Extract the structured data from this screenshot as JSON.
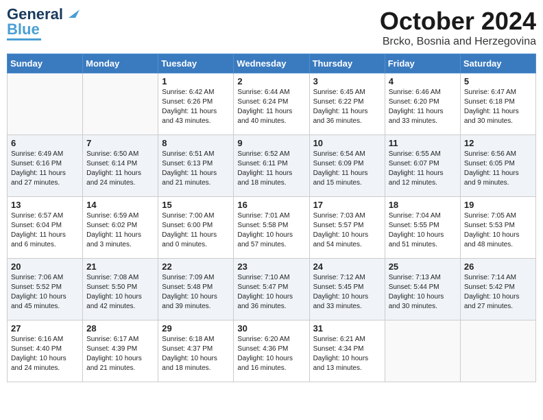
{
  "logo": {
    "line1": "General",
    "line2": "Blue"
  },
  "title": "October 2024",
  "location": "Brcko, Bosnia and Herzegovina",
  "days_of_week": [
    "Sunday",
    "Monday",
    "Tuesday",
    "Wednesday",
    "Thursday",
    "Friday",
    "Saturday"
  ],
  "weeks": [
    [
      {
        "day": "",
        "info": ""
      },
      {
        "day": "",
        "info": ""
      },
      {
        "day": "1",
        "info": "Sunrise: 6:42 AM\nSunset: 6:26 PM\nDaylight: 11 hours and 43 minutes."
      },
      {
        "day": "2",
        "info": "Sunrise: 6:44 AM\nSunset: 6:24 PM\nDaylight: 11 hours and 40 minutes."
      },
      {
        "day": "3",
        "info": "Sunrise: 6:45 AM\nSunset: 6:22 PM\nDaylight: 11 hours and 36 minutes."
      },
      {
        "day": "4",
        "info": "Sunrise: 6:46 AM\nSunset: 6:20 PM\nDaylight: 11 hours and 33 minutes."
      },
      {
        "day": "5",
        "info": "Sunrise: 6:47 AM\nSunset: 6:18 PM\nDaylight: 11 hours and 30 minutes."
      }
    ],
    [
      {
        "day": "6",
        "info": "Sunrise: 6:49 AM\nSunset: 6:16 PM\nDaylight: 11 hours and 27 minutes."
      },
      {
        "day": "7",
        "info": "Sunrise: 6:50 AM\nSunset: 6:14 PM\nDaylight: 11 hours and 24 minutes."
      },
      {
        "day": "8",
        "info": "Sunrise: 6:51 AM\nSunset: 6:13 PM\nDaylight: 11 hours and 21 minutes."
      },
      {
        "day": "9",
        "info": "Sunrise: 6:52 AM\nSunset: 6:11 PM\nDaylight: 11 hours and 18 minutes."
      },
      {
        "day": "10",
        "info": "Sunrise: 6:54 AM\nSunset: 6:09 PM\nDaylight: 11 hours and 15 minutes."
      },
      {
        "day": "11",
        "info": "Sunrise: 6:55 AM\nSunset: 6:07 PM\nDaylight: 11 hours and 12 minutes."
      },
      {
        "day": "12",
        "info": "Sunrise: 6:56 AM\nSunset: 6:05 PM\nDaylight: 11 hours and 9 minutes."
      }
    ],
    [
      {
        "day": "13",
        "info": "Sunrise: 6:57 AM\nSunset: 6:04 PM\nDaylight: 11 hours and 6 minutes."
      },
      {
        "day": "14",
        "info": "Sunrise: 6:59 AM\nSunset: 6:02 PM\nDaylight: 11 hours and 3 minutes."
      },
      {
        "day": "15",
        "info": "Sunrise: 7:00 AM\nSunset: 6:00 PM\nDaylight: 11 hours and 0 minutes."
      },
      {
        "day": "16",
        "info": "Sunrise: 7:01 AM\nSunset: 5:58 PM\nDaylight: 10 hours and 57 minutes."
      },
      {
        "day": "17",
        "info": "Sunrise: 7:03 AM\nSunset: 5:57 PM\nDaylight: 10 hours and 54 minutes."
      },
      {
        "day": "18",
        "info": "Sunrise: 7:04 AM\nSunset: 5:55 PM\nDaylight: 10 hours and 51 minutes."
      },
      {
        "day": "19",
        "info": "Sunrise: 7:05 AM\nSunset: 5:53 PM\nDaylight: 10 hours and 48 minutes."
      }
    ],
    [
      {
        "day": "20",
        "info": "Sunrise: 7:06 AM\nSunset: 5:52 PM\nDaylight: 10 hours and 45 minutes."
      },
      {
        "day": "21",
        "info": "Sunrise: 7:08 AM\nSunset: 5:50 PM\nDaylight: 10 hours and 42 minutes."
      },
      {
        "day": "22",
        "info": "Sunrise: 7:09 AM\nSunset: 5:48 PM\nDaylight: 10 hours and 39 minutes."
      },
      {
        "day": "23",
        "info": "Sunrise: 7:10 AM\nSunset: 5:47 PM\nDaylight: 10 hours and 36 minutes."
      },
      {
        "day": "24",
        "info": "Sunrise: 7:12 AM\nSunset: 5:45 PM\nDaylight: 10 hours and 33 minutes."
      },
      {
        "day": "25",
        "info": "Sunrise: 7:13 AM\nSunset: 5:44 PM\nDaylight: 10 hours and 30 minutes."
      },
      {
        "day": "26",
        "info": "Sunrise: 7:14 AM\nSunset: 5:42 PM\nDaylight: 10 hours and 27 minutes."
      }
    ],
    [
      {
        "day": "27",
        "info": "Sunrise: 6:16 AM\nSunset: 4:40 PM\nDaylight: 10 hours and 24 minutes."
      },
      {
        "day": "28",
        "info": "Sunrise: 6:17 AM\nSunset: 4:39 PM\nDaylight: 10 hours and 21 minutes."
      },
      {
        "day": "29",
        "info": "Sunrise: 6:18 AM\nSunset: 4:37 PM\nDaylight: 10 hours and 18 minutes."
      },
      {
        "day": "30",
        "info": "Sunrise: 6:20 AM\nSunset: 4:36 PM\nDaylight: 10 hours and 16 minutes."
      },
      {
        "day": "31",
        "info": "Sunrise: 6:21 AM\nSunset: 4:34 PM\nDaylight: 10 hours and 13 minutes."
      },
      {
        "day": "",
        "info": ""
      },
      {
        "day": "",
        "info": ""
      }
    ]
  ]
}
